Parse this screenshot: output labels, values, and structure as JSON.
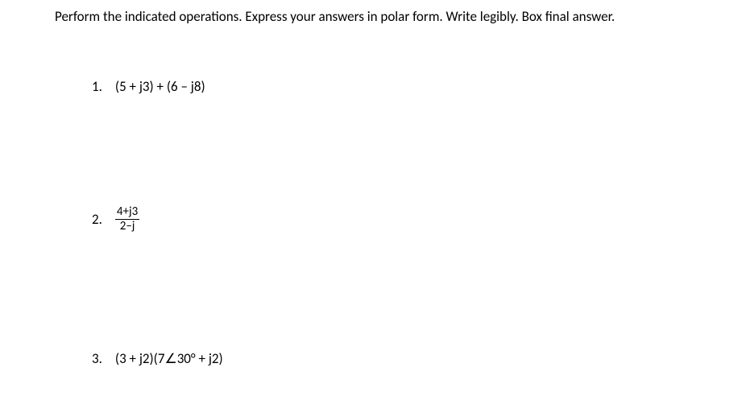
{
  "instructions": "Perform the indicated operations. Express your answers in polar form. Write legibly. Box final answer.",
  "problems": {
    "p1": {
      "number": "1.",
      "expression": "(5 + j3) + (6 – j8)"
    },
    "p2": {
      "number": "2.",
      "numerator": "4+j3",
      "denominator": "2–j"
    },
    "p3": {
      "number": "3.",
      "expression": "(3 + j2)(7∠30° + j2)"
    }
  }
}
